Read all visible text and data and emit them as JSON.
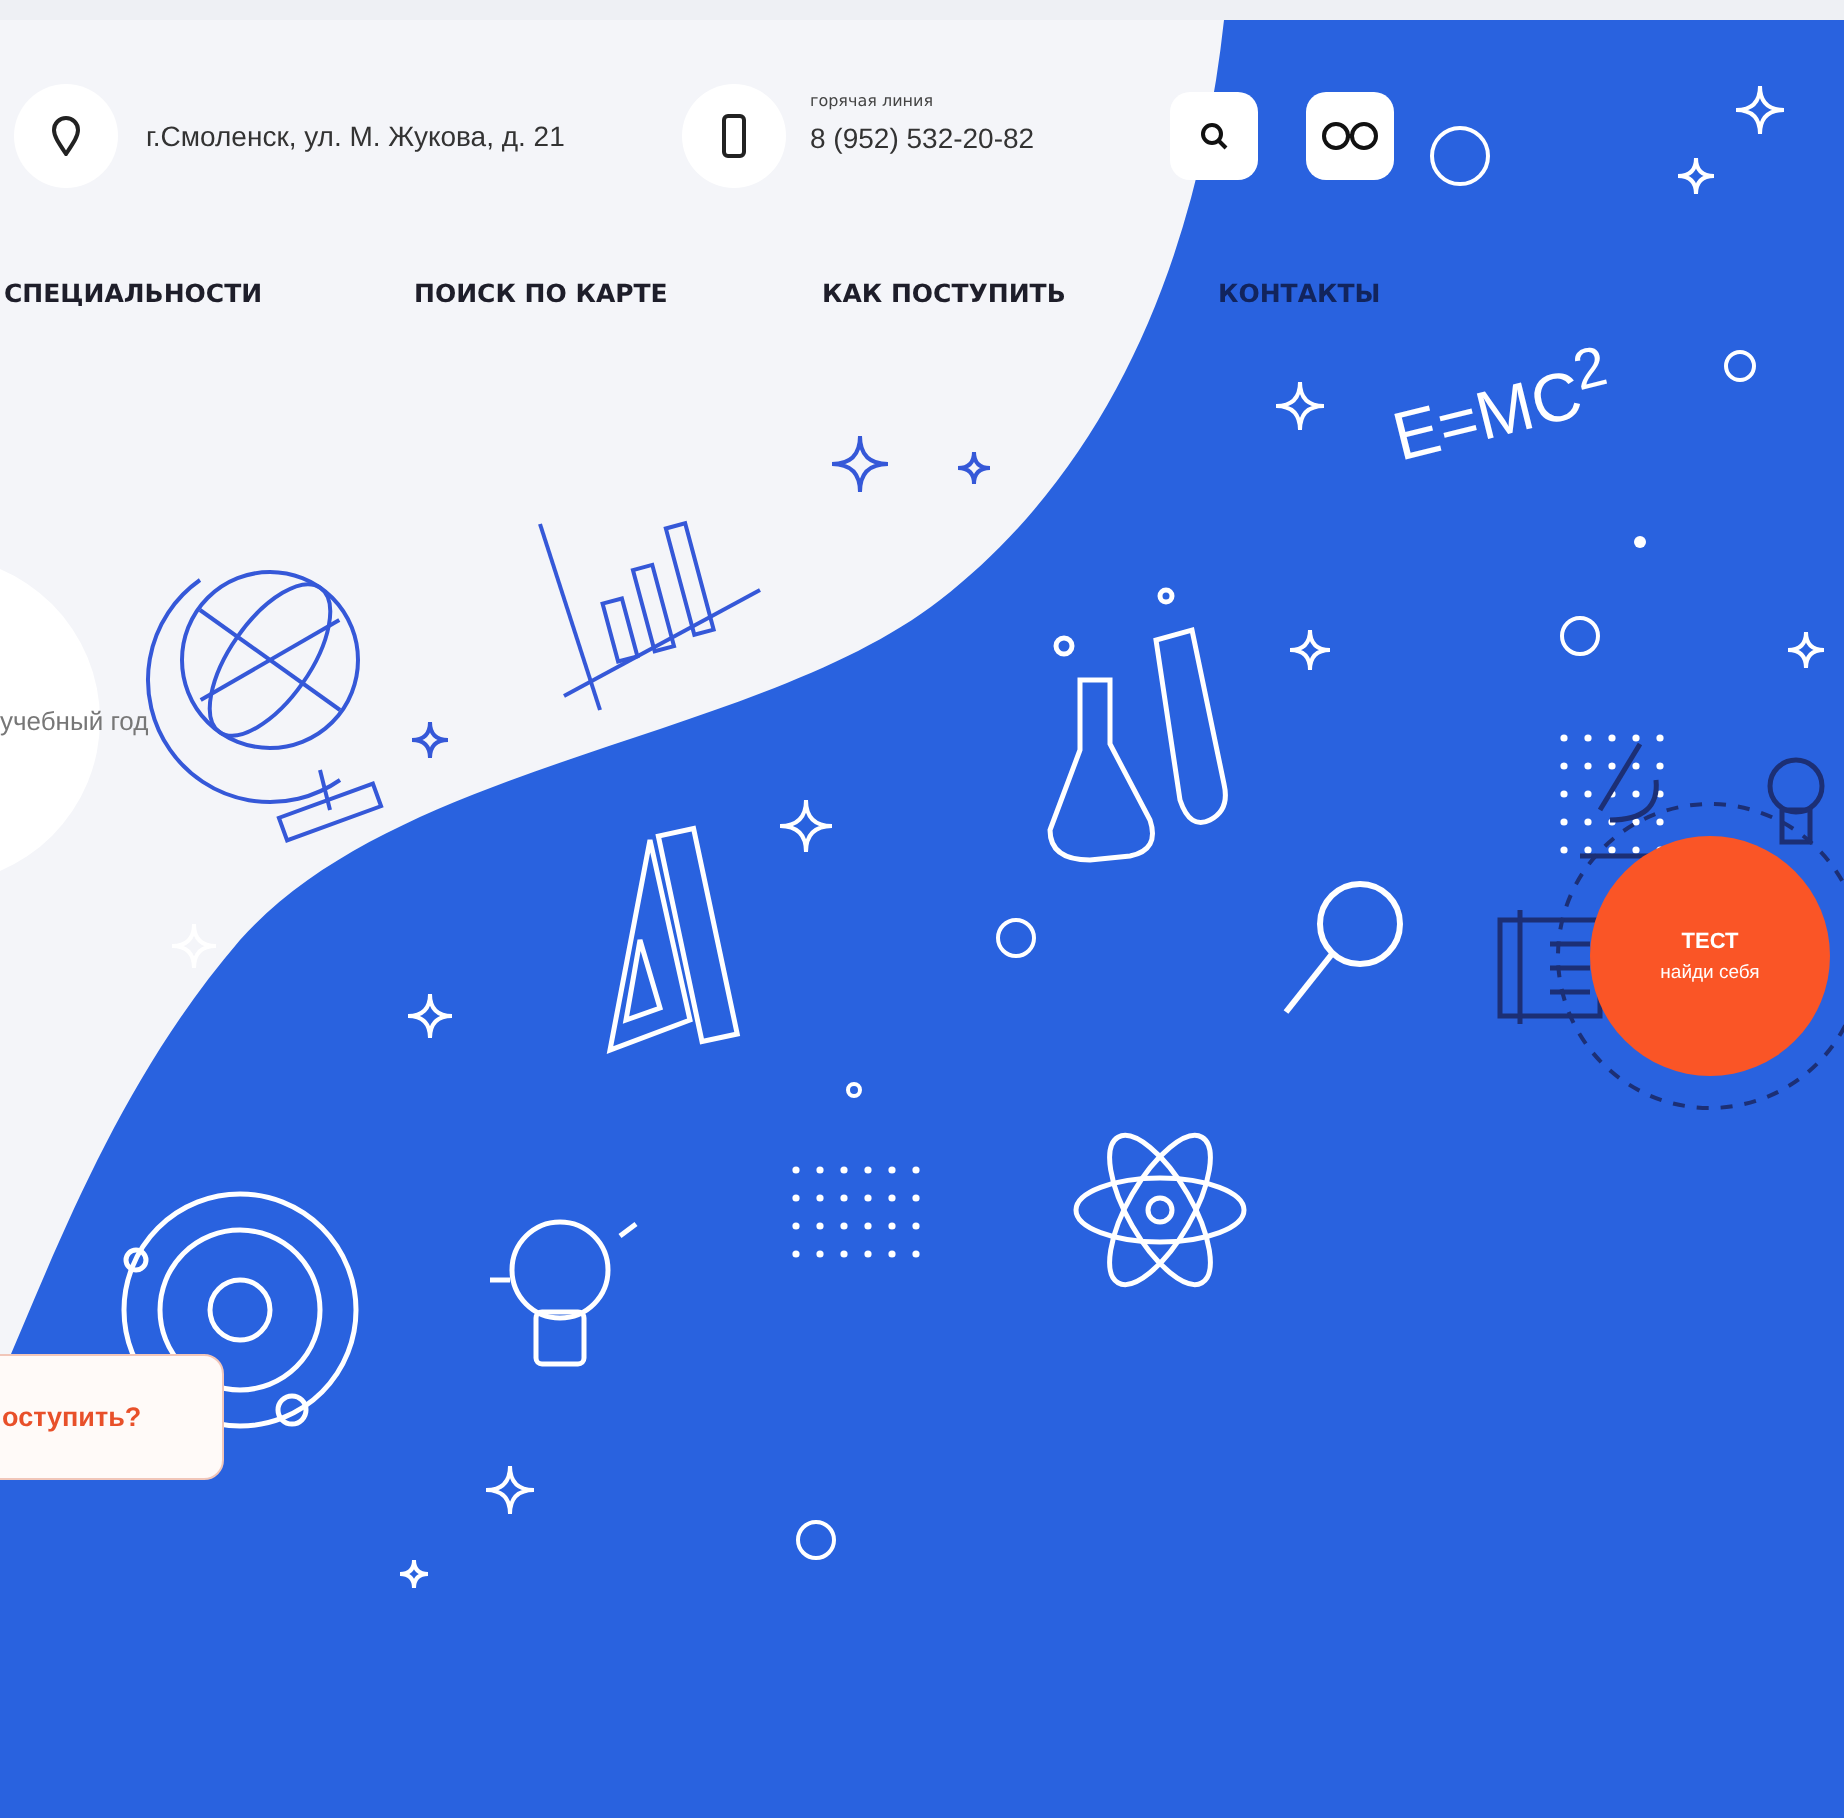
{
  "header": {
    "address": "г.Смоленск, ул. М. Жукова, д. 21",
    "hotline_label": "горячая линия",
    "phone": "8 (952) 532-20-82"
  },
  "nav": [
    {
      "label": "СПЕЦИАЛЬНОСТИ",
      "kind": "plain"
    },
    {
      "label": "ПОИСК ПО КАРТЕ",
      "kind": "plain"
    },
    {
      "label": "КАК ПОСТУПИТЬ",
      "kind": "plain"
    },
    {
      "label": "КОНТАКТЫ",
      "kind": "onblue"
    }
  ],
  "hero": {
    "year_text": "учебный год",
    "formula": "E=MC$^{2}$",
    "apply_button": "оступить?"
  },
  "test_badge": {
    "title": "ТЕСТ",
    "subtitle": "найди себя"
  }
}
